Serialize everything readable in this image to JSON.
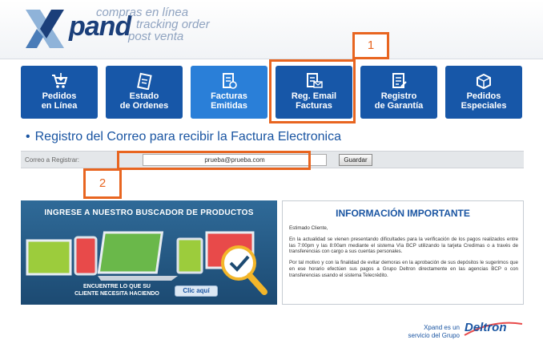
{
  "header": {
    "logo_text": "pand",
    "tagline": [
      "compras en línea",
      "tracking order",
      "post venta"
    ]
  },
  "nav": [
    {
      "label": "Pedidos\nen Línea",
      "icon": "cart-icon"
    },
    {
      "label": "Estado\nde Ordenes",
      "icon": "clipboard-icon"
    },
    {
      "label": "Facturas\nEmitidas",
      "icon": "invoice-icon"
    },
    {
      "label": "Reg. Email\nFacturas",
      "icon": "email-icon"
    },
    {
      "label": "Registro\nde Garantía",
      "icon": "warranty-icon"
    },
    {
      "label": "Pedidos\nEspeciales",
      "icon": "box-icon"
    }
  ],
  "callouts": {
    "one": "1",
    "two": "2"
  },
  "section_title": "Registro del Correo para recibir la Factura Electronica",
  "form": {
    "label": "Correo a Registrar:",
    "email_value": "prueba@prueba.com",
    "save_label": "Guardar"
  },
  "banner": {
    "title": "INGRESE A NUESTRO BUSCADOR DE PRODUCTOS",
    "note": "ENCUENTRE LO QUE SU\nCLIENTE NECESITA HACIENDO",
    "button": "Clic aquí"
  },
  "info": {
    "title": "INFORMACIÓN IMPORTANTE",
    "greeting": "Estimado Cliente,",
    "p1": "En la actualidad se vienen presentando dificultades para la verificación de los pagos realizados entre las 7:00pm y las 8:00am mediante el sistema Vía BCP utilizando la tarjeta Credimas o a través de transferencias con cargo a sus cuentas personales.",
    "p2": "Por tal motivo y con la finalidad de evitar demoras en la aprobación de sus depósitos le sugerimos que en ese horario efectúen sus pagos a Grupo Deltron directamente en las agencias BCP o con transferencias usando el sistema Telecrédito."
  },
  "footer": {
    "text": "Xpand es un\nservicio del Grupo",
    "brand": "Deltron"
  },
  "colors": {
    "primary": "#1757a8",
    "active": "#2a7fd8",
    "callout": "#e86520"
  }
}
